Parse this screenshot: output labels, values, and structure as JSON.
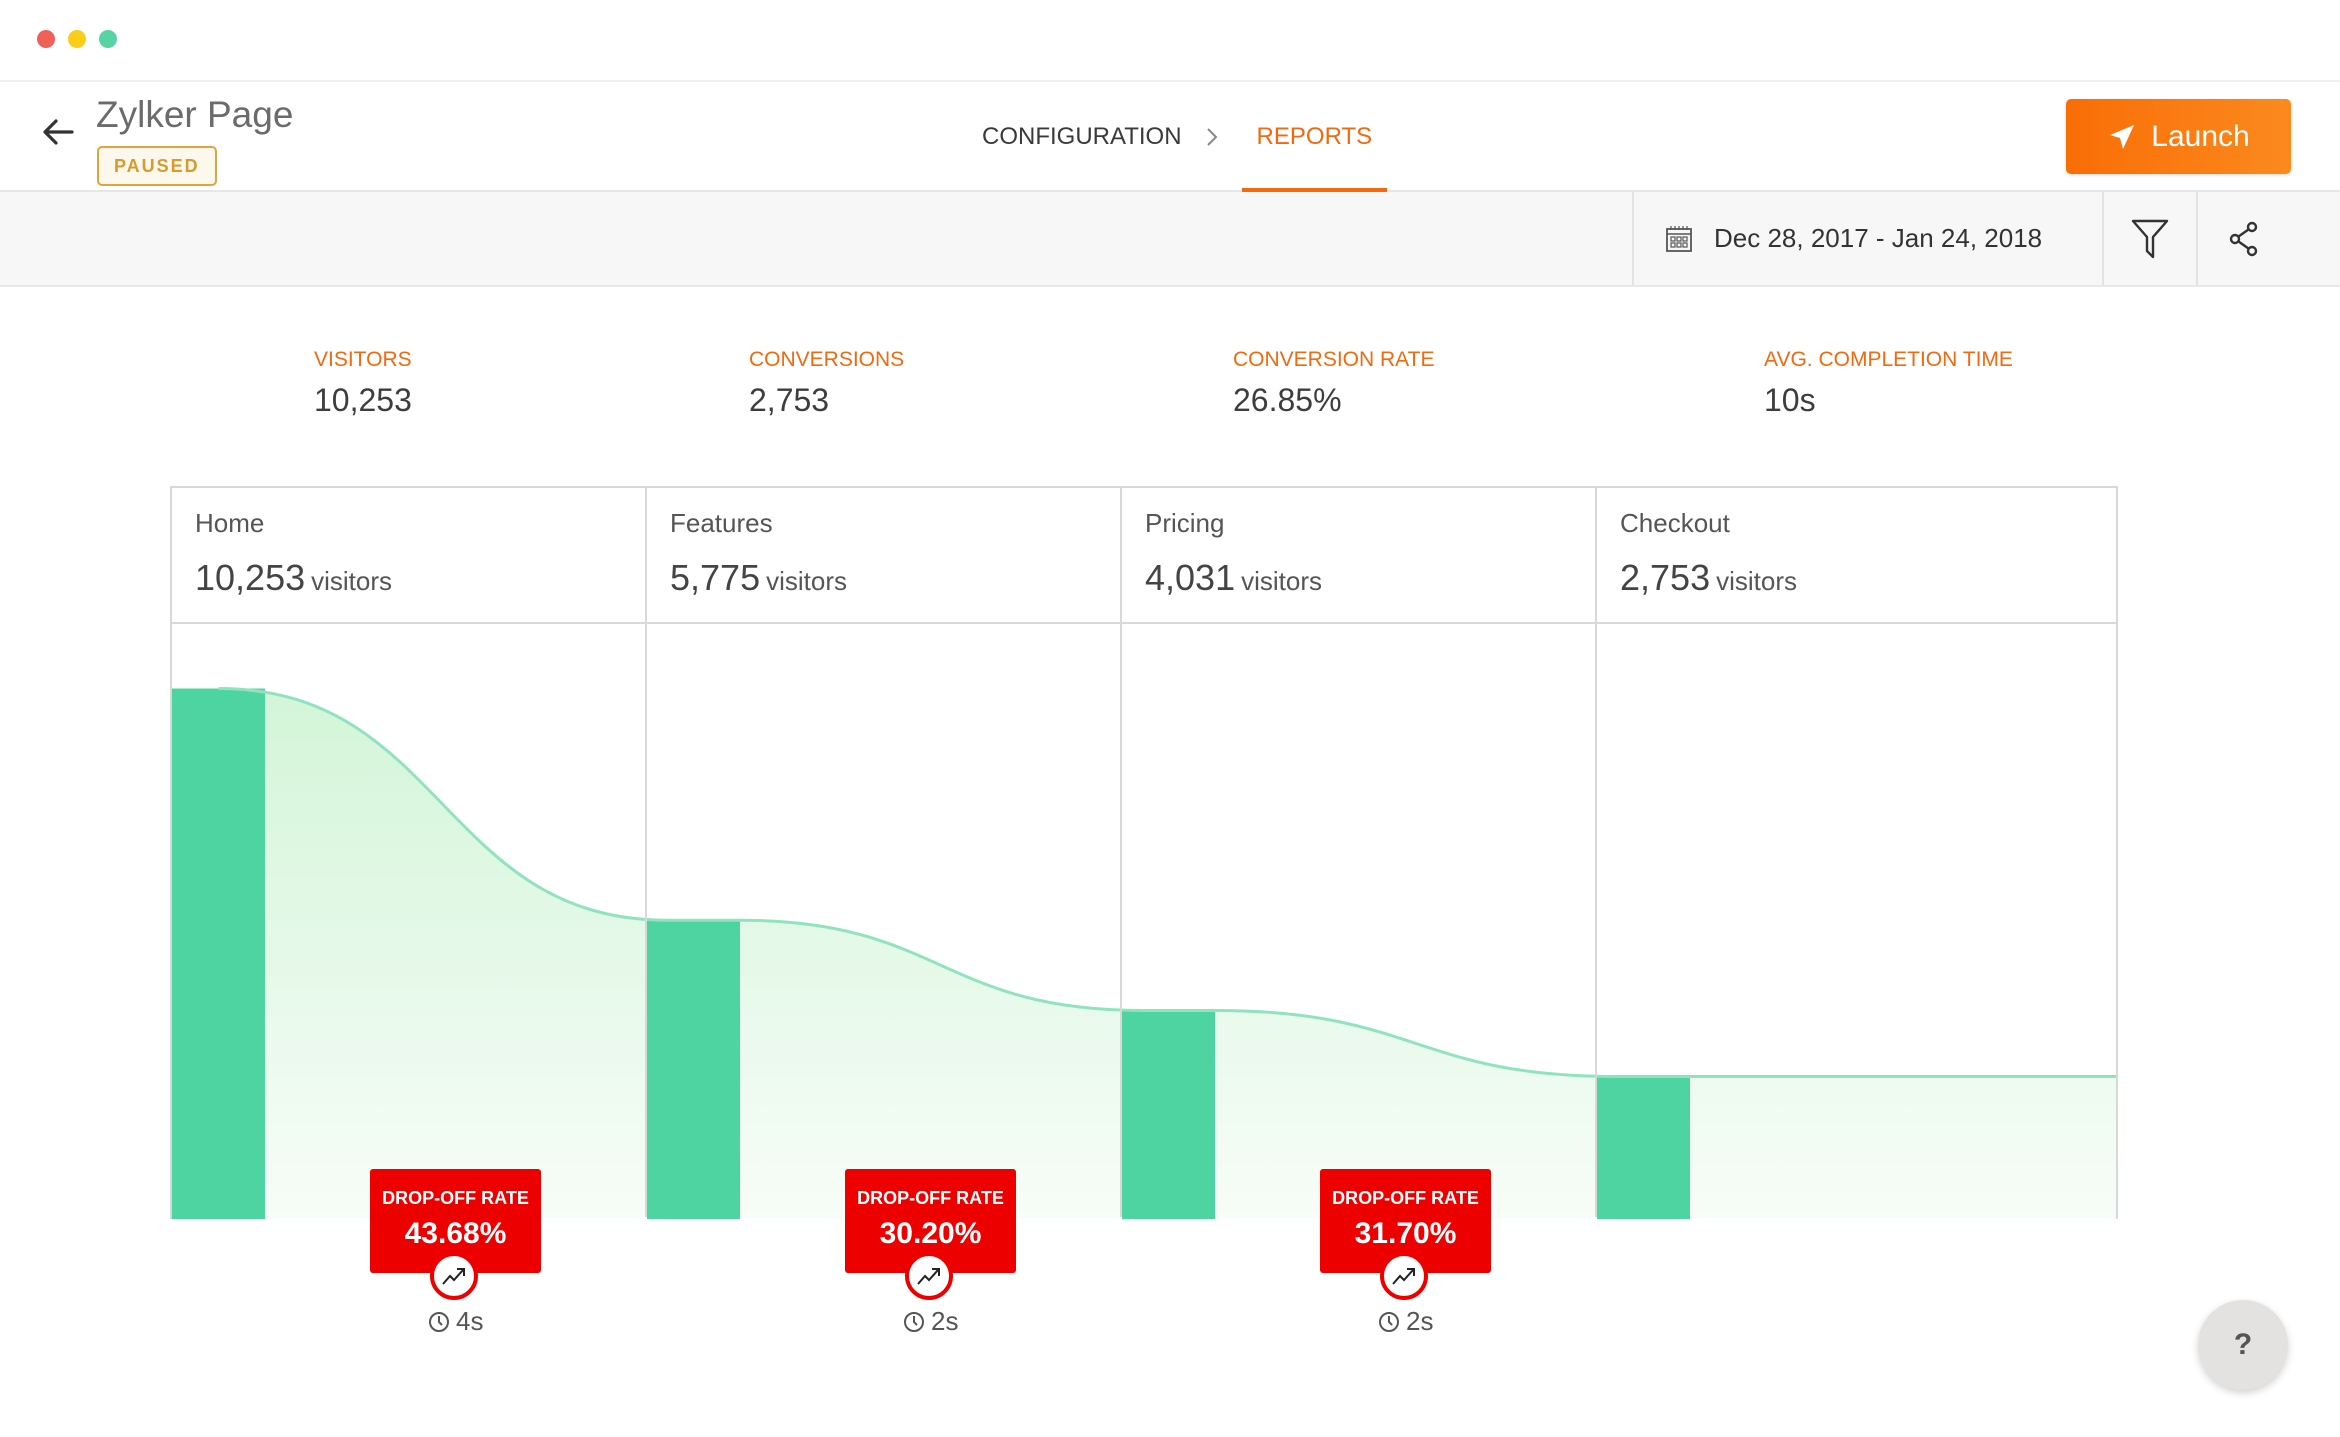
{
  "window": {
    "controls": [
      "close",
      "minimize",
      "maximize"
    ]
  },
  "header": {
    "title": "Zylker Page",
    "status": "PAUSED",
    "steps": [
      {
        "label": "CONFIGURATION",
        "active": false
      },
      {
        "label": "REPORTS",
        "active": true
      }
    ],
    "launch_label": "Launch"
  },
  "toolbar": {
    "date_range": "Dec 28, 2017 - Jan 24, 2018",
    "icons": [
      "calendar-icon",
      "filter-icon",
      "share-icon"
    ]
  },
  "metrics": [
    {
      "label": "VISITORS",
      "value": "10,253"
    },
    {
      "label": "CONVERSIONS",
      "value": "2,753"
    },
    {
      "label": "CONVERSION RATE",
      "value": "26.85%"
    },
    {
      "label": "AVG. COMPLETION TIME",
      "value": "10s"
    }
  ],
  "funnel": {
    "unit_label": "visitors",
    "stages": [
      {
        "name": "Home",
        "visitors_text": "10,253"
      },
      {
        "name": "Features",
        "visitors_text": "5,775"
      },
      {
        "name": "Pricing",
        "visitors_text": "4,031"
      },
      {
        "name": "Checkout",
        "visitors_text": "2,753"
      }
    ],
    "dropoffs": [
      {
        "label": "DROP-OFF RATE",
        "value": "43.68%",
        "time": "4s"
      },
      {
        "label": "DROP-OFF RATE",
        "value": "30.20%",
        "time": "2s"
      },
      {
        "label": "DROP-OFF RATE",
        "value": "31.70%",
        "time": "2s"
      }
    ]
  },
  "chart_data": {
    "type": "bar",
    "title": "",
    "categories": [
      "Home",
      "Features",
      "Pricing",
      "Checkout"
    ],
    "values": [
      10253,
      5775,
      4031,
      2753
    ],
    "ylim": [
      0,
      11500
    ],
    "xlabel": "",
    "ylabel": "",
    "grid": false,
    "overlay": "area",
    "colors": {
      "bar": "#4dd4a0",
      "line": "#8fe3bf",
      "area_top": "#d3f5d8",
      "area_bottom": "#f7fdf8"
    }
  },
  "help": {
    "label": "?"
  }
}
